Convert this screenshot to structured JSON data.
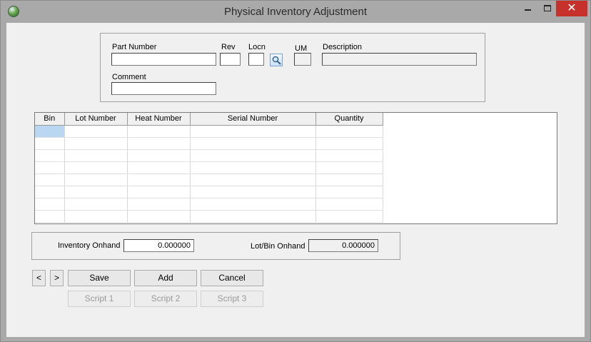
{
  "window": {
    "title": "Physical Inventory Adjustment",
    "minimize_glyph": "",
    "close_glyph": "✕"
  },
  "form": {
    "part_number_label": "Part Number",
    "part_number_value": "",
    "rev_label": "Rev",
    "rev_value": "",
    "locn_label": "Locn",
    "locn_value": "",
    "um_label": "UM",
    "um_value": "",
    "description_label": "Description",
    "description_value": "",
    "comment_label": "Comment",
    "comment_value": ""
  },
  "grid": {
    "columns": [
      "Bin",
      "Lot Number",
      "Heat Number",
      "Serial Number",
      "Quantity"
    ],
    "row_count": 8
  },
  "onhand": {
    "inventory_label": "Inventory Onhand",
    "inventory_value": "0.000000",
    "lotbin_label": "Lot/Bin Onhand",
    "lotbin_value": "0.000000"
  },
  "buttons": {
    "prev": "<",
    "next": ">",
    "save": "Save",
    "add": "Add",
    "cancel": "Cancel",
    "script1": "Script 1",
    "script2": "Script 2",
    "script3": "Script 3"
  },
  "icons": {
    "app": "app-globe-icon",
    "search": "magnifier-icon"
  },
  "colors": {
    "titlebar": "#a9a9a9",
    "close_button": "#c7312b",
    "selected_cell": "#b9d7f0",
    "client_background": "#f0f0f0"
  }
}
